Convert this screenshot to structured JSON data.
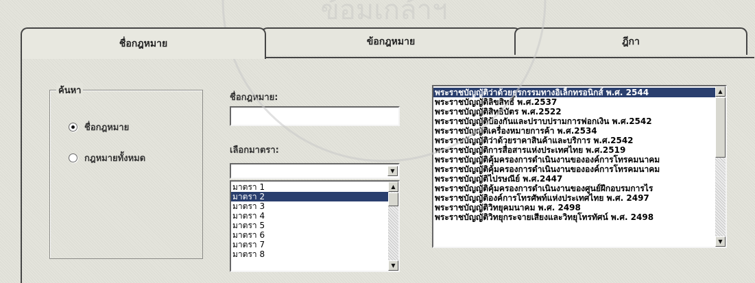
{
  "tabs": [
    {
      "label": "ชื่อกฎหมาย",
      "active": true
    },
    {
      "label": "ข้อกฎหมาย",
      "active": false
    },
    {
      "label": "ฎีกา",
      "active": false
    }
  ],
  "search_group": {
    "title": "ค้นหา",
    "options": [
      {
        "label": "ชื่อกฎหมาย",
        "selected": true
      },
      {
        "label": "กฎหมายทั้งหมด",
        "selected": false
      }
    ]
  },
  "law_name": {
    "label": "ชื่อกฎหมาย:",
    "value": ""
  },
  "section": {
    "label": "เลือกมาตรา:",
    "combo_value": "",
    "items": [
      "มาตรา 1",
      "มาตรา 2",
      "มาตรา 3",
      "มาตรา 4",
      "มาตรา 5",
      "มาตรา 6",
      "มาตรา 7",
      "มาตรา 8"
    ],
    "selected_index": 1
  },
  "law_list": {
    "items": [
      "พระราชบัญญัติว่าด้วยธุรกรรมทางอิเล็กทรอนิกส์ พ.ศ. 2544",
      "พระราชบัญญัติลิขสิทธิ์ พ.ศ.2537",
      "พระราชบัญญัติสิทธิบัตร พ.ศ.2522",
      "พระราชบัญญัติป้องกันและปราบปรามการฟอกเงิน พ.ศ.2542",
      "พระราชบัญญัติเครื่องหมายการค้า พ.ศ.2534",
      "พระราชบัญญัติว่าด้วยราคาสินค้าและบริการ พ.ศ.2542",
      "พระราชบัญญัติการสื่อสารแห่งประเทศไทย พ.ศ.2519",
      "พระราชบัญญัติคุ้มครองการดำเนินงานขององค์การโทรคมนาคม",
      "พระราชบัญญัติคุ้มครองการดำเนินงานขององค์การโทรคมนาคม",
      "พระราชบัญญัติไปรษณีย์ พ.ศ.2447",
      "พระราชบัญญัติคุ้มครองการดำเนินงานของศูนย์ฝึกอบรมการไร",
      "พระราชบัญญัติองค์การโทรศัพท์แห่งประเทศไทย พ.ศ. 2497",
      "พระราชบัญญัติวิทยุคมนาคม พ.ศ. 2498",
      "พระราชบัญญัติวิทยุกระจายเสียงและวิทยุโทรทัศน์ พ.ศ. 2498"
    ],
    "selected_index": 0
  },
  "watermark": {
    "text": "ข้อมเกล้าฯ"
  },
  "colors": {
    "selection": "#2a3f6e",
    "background": "#e4e4dc"
  }
}
